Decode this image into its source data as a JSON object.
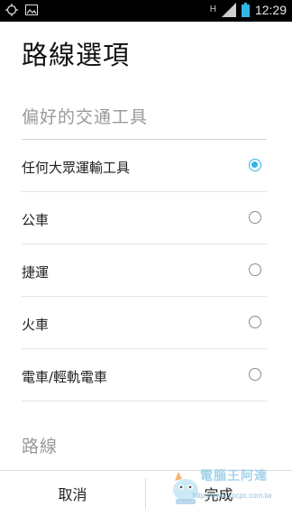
{
  "status_bar": {
    "time": "12:29",
    "network_letter": "H",
    "icons": [
      "gps-icon",
      "image-notification-icon",
      "signal-icon",
      "battery-icon"
    ]
  },
  "dialog": {
    "title": "路線選項",
    "section_transport": "偏好的交通工具",
    "options": [
      {
        "label": "任何大眾運輸工具",
        "checked": true
      },
      {
        "label": "公車",
        "checked": false
      },
      {
        "label": "捷運",
        "checked": false
      },
      {
        "label": "火車",
        "checked": false
      },
      {
        "label": "電車/輕軌電車",
        "checked": false
      }
    ],
    "section_route": "路線"
  },
  "buttons": {
    "cancel": "取消",
    "done": "完成"
  },
  "watermark": {
    "title": "電腦王阿達",
    "url": "http://www.kocpc.com.tw"
  },
  "colors": {
    "accent": "#33b5e5",
    "section_text": "#999999"
  }
}
